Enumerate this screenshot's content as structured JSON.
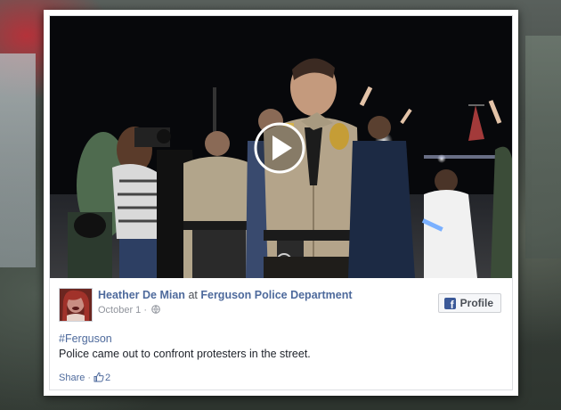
{
  "post": {
    "author": "Heather De Mian",
    "at_word": "at",
    "page": "Ferguson Police Department",
    "date": "October 1",
    "date_separator": "·",
    "hashtag": "#Ferguson",
    "text": "Police came out to confront protesters in the street.",
    "profile_button": "Profile",
    "share_label": "Share",
    "actions_separator": "·",
    "like_count": "2"
  },
  "video": {
    "play_icon": "play-icon"
  },
  "colors": {
    "link_blue": "#4e6a9c",
    "facebook_blue": "#3b5998",
    "meta_gray": "#90949c"
  }
}
